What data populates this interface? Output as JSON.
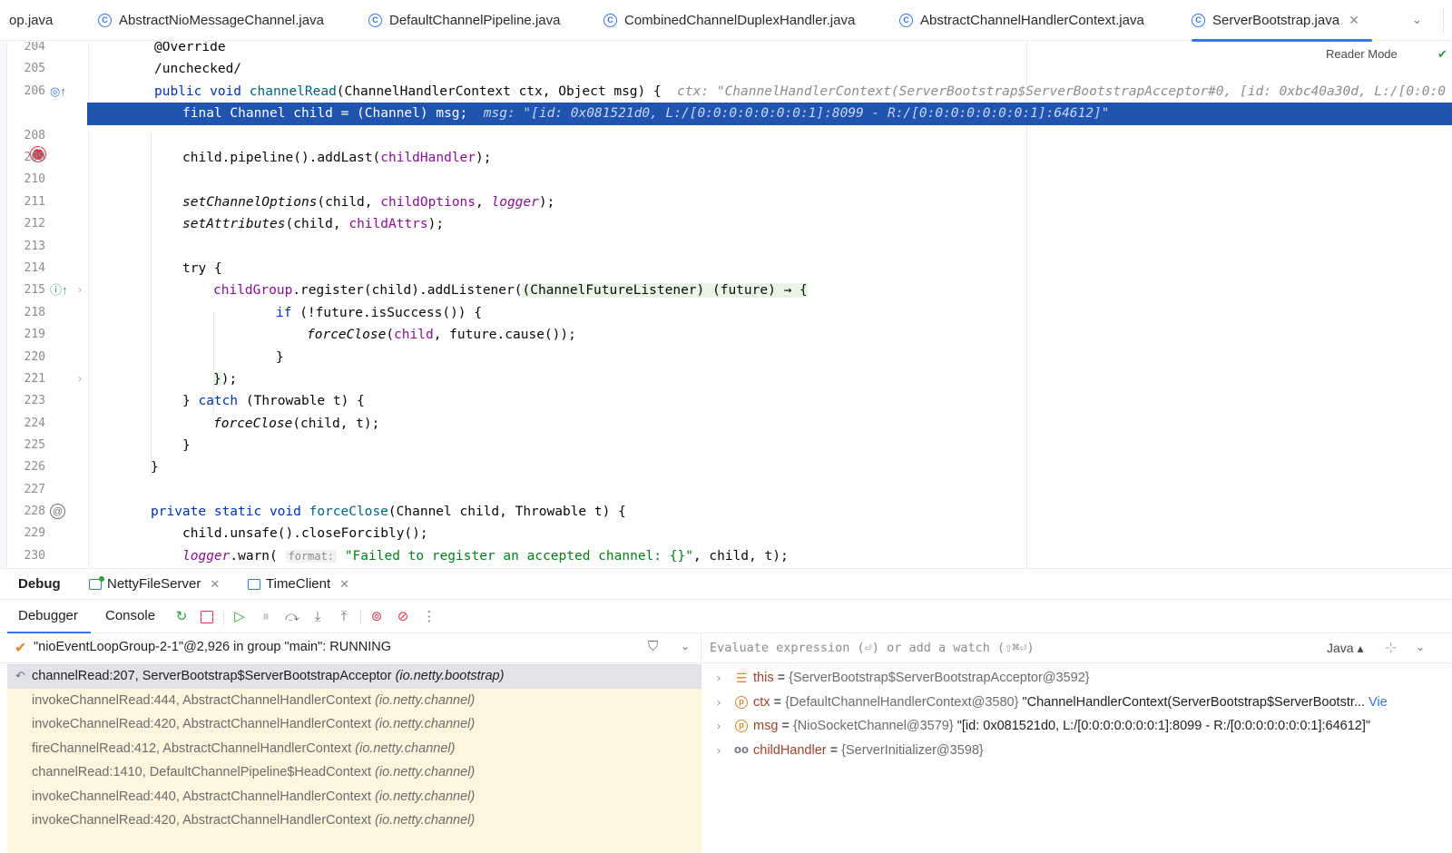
{
  "tabs": [
    {
      "label": "op.java",
      "icon": "none"
    },
    {
      "label": "AbstractNioMessageChannel.java",
      "icon": "class-icon"
    },
    {
      "label": "DefaultChannelPipeline.java",
      "icon": "class-icon"
    },
    {
      "label": "CombinedChannelDuplexHandler.java",
      "icon": "class-icon"
    },
    {
      "label": "AbstractChannelHandlerContext.java",
      "icon": "class-icon"
    },
    {
      "label": "ServerBootstrap.java",
      "icon": "class-icon",
      "active": true
    }
  ],
  "editor": {
    "reader_mode": "Reader Mode",
    "lines": [
      {
        "num": "204",
        "code": "@Override"
      },
      {
        "num": "205",
        "code": "/unchecked/"
      },
      {
        "num": "206",
        "code": "public void channelRead(ChannelHandlerContext ctx, Object msg) {",
        "hint": "ctx: \"ChannelHandlerContext(ServerBootstrap$ServerBootstrapAcceptor#0, [id: 0xbc40a30d, L:/[0:0:0"
      },
      {
        "num": "",
        "code": "final Channel child = (Channel) msg;",
        "hint": "msg: \"[id: 0x081521d0, L:/[0:0:0:0:0:0:0:1]:8099 - R:/[0:0:0:0:0:0:0:1]:64612]\""
      },
      {
        "num": "208",
        "code": ""
      },
      {
        "num": "209",
        "code": "child.pipeline().addLast(childHandler);"
      },
      {
        "num": "210",
        "code": ""
      },
      {
        "num": "211",
        "code": "setChannelOptions(child, childOptions, logger);"
      },
      {
        "num": "212",
        "code": "setAttributes(child, childAttrs);"
      },
      {
        "num": "213",
        "code": ""
      },
      {
        "num": "214",
        "code": "try {"
      },
      {
        "num": "215",
        "code": "childGroup.register(child).addListener((ChannelFutureListener) (future) → {"
      },
      {
        "num": "218",
        "code": "if (!future.isSuccess()) {"
      },
      {
        "num": "219",
        "code": "forceClose(child, future.cause());"
      },
      {
        "num": "220",
        "code": "}"
      },
      {
        "num": "221",
        "code": "});"
      },
      {
        "num": "223",
        "code": "} catch (Throwable t) {"
      },
      {
        "num": "224",
        "code": "forceClose(child, t);"
      },
      {
        "num": "225",
        "code": "}"
      },
      {
        "num": "226",
        "code": "}"
      },
      {
        "num": "227",
        "code": ""
      },
      {
        "num": "228",
        "code": "private static void forceClose(Channel child, Throwable t) {"
      },
      {
        "num": "229",
        "code": "child.unsafe().closeForcibly();"
      },
      {
        "num": "230",
        "code": "logger.warn( format: \"Failed to register an accepted channel: {}\", child, t);"
      }
    ]
  },
  "debug": {
    "title": "Debug",
    "sessions": [
      {
        "label": "NettyFileServer"
      },
      {
        "label": "TimeClient"
      }
    ],
    "subtabs": {
      "debugger": "Debugger",
      "console": "Console"
    },
    "thread": "\"nioEventLoopGroup-2-1\"@2,926 in group \"main\": RUNNING",
    "frames": [
      {
        "method": "channelRead:207, ServerBootstrap$ServerBootstrapAcceptor",
        "pkg": "(io.netty.bootstrap)"
      },
      {
        "method": "invokeChannelRead:444, AbstractChannelHandlerContext",
        "pkg": "(io.netty.channel)"
      },
      {
        "method": "invokeChannelRead:420, AbstractChannelHandlerContext",
        "pkg": "(io.netty.channel)"
      },
      {
        "method": "fireChannelRead:412, AbstractChannelHandlerContext",
        "pkg": "(io.netty.channel)"
      },
      {
        "method": "channelRead:1410, DefaultChannelPipeline$HeadContext",
        "pkg": "(io.netty.channel)"
      },
      {
        "method": "invokeChannelRead:440, AbstractChannelHandlerContext",
        "pkg": "(io.netty.channel)"
      },
      {
        "method": "invokeChannelRead:420, AbstractChannelHandlerContext",
        "pkg": "(io.netty.channel)"
      }
    ],
    "evaluate_placeholder": "Evaluate expression (⏎) or add a watch (⇧⌘⏎)",
    "language": "Java",
    "variables": [
      {
        "name": "this",
        "type": "{ServerBootstrap$ServerBootstrapAcceptor@3592}",
        "value": "",
        "icon": "stack-icon"
      },
      {
        "name": "ctx",
        "type": "{DefaultChannelHandlerContext@3580}",
        "value": "\"ChannelHandlerContext(ServerBootstrap$ServerBootstr...",
        "link": "Vie",
        "icon": "param-icon"
      },
      {
        "name": "msg",
        "type": "{NioSocketChannel@3579}",
        "value": "\"[id: 0x081521d0, L:/[0:0:0:0:0:0:0:1]:8099 - R:/[0:0:0:0:0:0:0:1]:64612]\"",
        "icon": "param-icon"
      },
      {
        "name": "childHandler",
        "type": "{ServerInitializer@3598}",
        "value": "",
        "icon": "field-icon"
      }
    ]
  }
}
